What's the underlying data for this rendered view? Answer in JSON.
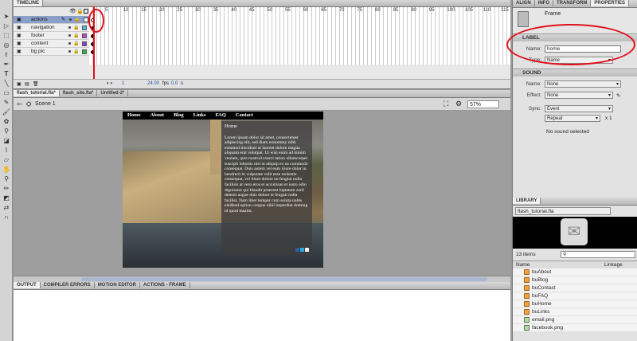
{
  "timeline": {
    "tab": "TIMELINE",
    "frame_numbers": [
      "5",
      "10",
      "15",
      "20",
      "25",
      "30",
      "35",
      "40",
      "45",
      "50",
      "55",
      "60",
      "65",
      "70",
      "75",
      "80",
      "85",
      "90",
      "95",
      "100",
      "105",
      "110",
      "115"
    ],
    "layers": [
      {
        "name": "actions",
        "selected": true,
        "color": "#ffffff"
      },
      {
        "name": "navigation",
        "selected": false,
        "color": "#3ec8e8"
      },
      {
        "name": "footer",
        "selected": false,
        "color": "#c845d8"
      },
      {
        "name": "content",
        "selected": false,
        "color": "#8a3fd8"
      },
      {
        "name": "bg pic",
        "selected": false,
        "color": "#2bbb3a"
      }
    ],
    "current_frame": "1",
    "fps": "24.00",
    "fps_unit": "fps",
    "time": "0.0",
    "time_unit": "s"
  },
  "doc_tabs": [
    "flash_tutorial.fla*",
    "flash_site.fla*",
    "Untitled-2*"
  ],
  "scene": {
    "label": "Scene 1",
    "zoom": "57%"
  },
  "site": {
    "nav": [
      "Home",
      "About",
      "Blog",
      "Links",
      "FAQ",
      "Contact"
    ],
    "heading": "Home",
    "body": "Lorem ipsum dolor sit amet, consectetuer adipiscing elit, sed diam nonummy nibh euismod tincidunt ut laoreet dolore magna aliquam erat volutpat. Ut wisi enim ad minim veniam, quis nostrud exerci tation ullamcorper suscipit lobortis nisl ut aliquip ex ea commodo consequat. Duis autem vel eum iriure dolor in hendrerit in vulputate velit esse molestie consequat, vel illum dolore eu feugiat nulla facilisis at vero eros et accumsan et iusto odio dignissim qui blandit praesent luptatum zzril delenit augue duis dolore te feugait nulla facilisi.  Nam liber tempor cum soluta nobis eleifend option congue nihil imperdiet doming id quod mazim."
  },
  "output_tabs": [
    "OUTPUT",
    "COMPILER ERRORS",
    "MOTION EDITOR",
    "ACTIONS - FRAME"
  ],
  "right": {
    "tabs": [
      "ALIGN",
      "INFO",
      "TRANSFORM",
      "PROPERTIES"
    ],
    "frame_label": "Frame",
    "label_section": "LABEL",
    "name_label": "Name:",
    "name_value": "home",
    "type_label": "Type:",
    "type_value": "Name",
    "sound_section": "SOUND",
    "sound_name_label": "Name:",
    "sound_name_value": "None",
    "effect_label": "Effect:",
    "effect_value": "None",
    "sync_label": "Sync:",
    "sync_value": "Event",
    "repeat_value": "Repeat",
    "repeat_count": "x 1",
    "no_sound": "No sound selected",
    "library_tab": "LIBRARY",
    "library_file": "flash_tutorial.fla",
    "item_count": "13 items",
    "col_name": "Name",
    "col_linkage": "Linkage",
    "items": [
      {
        "name": "buAbout",
        "type": "button"
      },
      {
        "name": "buBlog",
        "type": "button"
      },
      {
        "name": "buContact",
        "type": "button"
      },
      {
        "name": "buFAQ",
        "type": "button"
      },
      {
        "name": "buHome",
        "type": "button"
      },
      {
        "name": "buLinks",
        "type": "button"
      },
      {
        "name": "email.png",
        "type": "image"
      },
      {
        "name": "facebook.png",
        "type": "image"
      }
    ]
  },
  "colors": {
    "highlight_circle": "#e0101a",
    "selection": "#8aa0c8",
    "playhead": "#e0101a"
  }
}
